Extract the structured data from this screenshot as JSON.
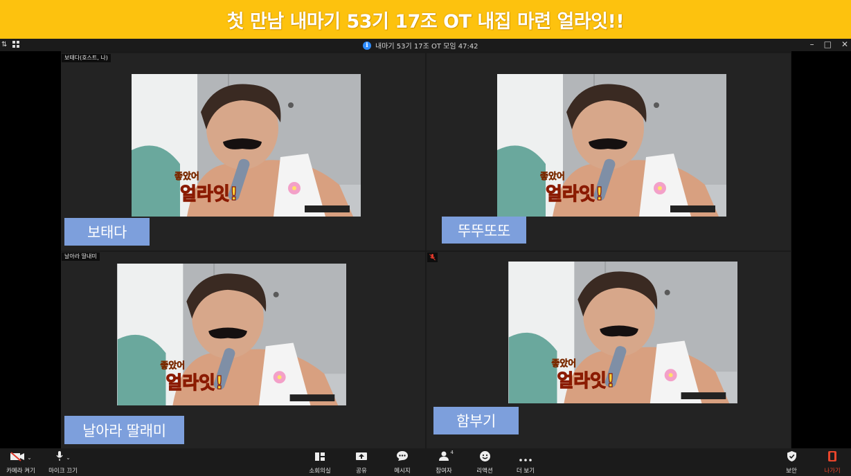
{
  "banner": {
    "text": "첫 만남 내마기 53기 17조  OT 내집 마련 얼라잇!!"
  },
  "titlebar": {
    "title": "내마기 53기 17조 OT 모임 47:42",
    "info_icon": "i"
  },
  "participants": [
    {
      "tag": "보태다(호스트, 나)",
      "name": "보태다",
      "mic_muted": false
    },
    {
      "tag": "",
      "name": "뚜뚜또또",
      "mic_muted": false
    },
    {
      "tag": "날아라 딸내미",
      "name": "날아라 딸래미",
      "mic_muted": false
    },
    {
      "tag": "",
      "name": "함부기",
      "mic_muted": true
    }
  ],
  "video_caption": {
    "small": "좋았어",
    "big": "얼라잇!"
  },
  "toolbar": {
    "camera_label": "카메라 켜기",
    "mic_label": "마이크 끄기",
    "breakout_label": "소회의실",
    "share_label": "공유",
    "chat_label": "메시지",
    "participants_label": "참여자",
    "participants_count": "4",
    "reactions_label": "리액션",
    "more_label": "더 보기",
    "security_label": "보안",
    "leave_label": "나가기"
  },
  "colors": {
    "banner": "#fdc20e",
    "name_box": "#7d9fdc",
    "leave": "#e8452b",
    "info": "#2d8cff"
  }
}
